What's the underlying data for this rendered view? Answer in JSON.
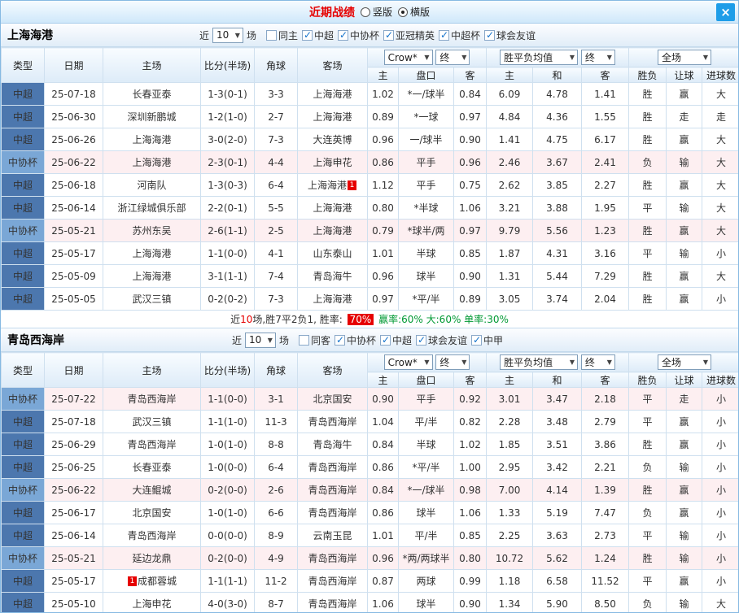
{
  "titlebar": {
    "title": "近期战绩",
    "radios": [
      {
        "label": "竖版",
        "selected": false
      },
      {
        "label": "横版",
        "selected": true
      }
    ],
    "close": "×"
  },
  "table_header": {
    "type": "类型",
    "date": "日期",
    "home": "主场",
    "score": "比分(半场)",
    "corner": "角球",
    "away": "客场",
    "asia_select": "Crow*",
    "asia_final": "终",
    "europe_select": "胜平负均值",
    "europe_final": "终",
    "full_select": "全场",
    "sub": [
      "主",
      "盘口",
      "客",
      "主",
      "和",
      "客",
      "胜负",
      "让球",
      "进球数"
    ]
  },
  "sections": [
    {
      "team": "上海海港",
      "filter": {
        "prefix": "近",
        "count": "10",
        "suffix": "场",
        "options": [
          {
            "label": "同主",
            "checked": false
          },
          {
            "label": "中超",
            "checked": true
          },
          {
            "label": "中协杯",
            "checked": true
          },
          {
            "label": "亚冠精英",
            "checked": true
          },
          {
            "label": "中超杯",
            "checked": true
          },
          {
            "label": "球会友谊",
            "checked": true
          }
        ]
      },
      "rows": [
        {
          "lg": "中超",
          "date": "25-07-18",
          "home": "长春亚泰",
          "home_c": "k",
          "score": "1-3(0-1)",
          "corner": "3-3",
          "away": "上海海港",
          "away_c": "g",
          "a1": "1.02",
          "hc": "*一/球半",
          "hc_c": "r",
          "a2": "0.84",
          "e1": "6.09",
          "e2": "4.78",
          "e3": "1.41",
          "r1": "胜",
          "r1c": "r",
          "r2": "赢",
          "r2c": "r",
          "r3": "大",
          "r3c": "r"
        },
        {
          "lg": "中超",
          "date": "25-06-30",
          "home": "深圳新鹏城",
          "home_c": "k",
          "score": "1-2(1-0)",
          "corner": "2-7",
          "away": "上海海港",
          "away_c": "g",
          "a1": "0.89",
          "hc": "*一球",
          "hc_c": "r",
          "a2": "0.97",
          "e1": "4.84",
          "e2": "4.36",
          "e3": "1.55",
          "r1": "胜",
          "r1c": "r",
          "r2": "走",
          "r2c": "b",
          "r3": "走",
          "r3c": "b"
        },
        {
          "lg": "中超",
          "date": "25-06-26",
          "home": "上海海港",
          "home_c": "r",
          "score": "3-0(2-0)",
          "corner": "7-3",
          "away": "大连英博",
          "away_c": "k",
          "a1": "0.96",
          "hc": "一/球半",
          "hc_c": "k",
          "a2": "0.90",
          "e1": "1.41",
          "e2": "4.75",
          "e3": "6.17",
          "r1": "胜",
          "r1c": "r",
          "r2": "赢",
          "r2c": "r",
          "r3": "大",
          "r3c": "r"
        },
        {
          "lg": "中协杯",
          "date": "25-06-22",
          "home": "上海海港",
          "home_c": "r",
          "score": "2-3(0-1)",
          "corner": "4-4",
          "away": "上海申花",
          "away_c": "k",
          "a1": "0.86",
          "hc": "平手",
          "hc_c": "k",
          "a2": "0.96",
          "e1": "2.46",
          "e2": "3.67",
          "e3": "2.41",
          "r1": "负",
          "r1c": "g",
          "r2": "输",
          "r2c": "g",
          "r3": "大",
          "r3c": "r"
        },
        {
          "lg": "中超",
          "date": "25-06-18",
          "home": "河南队",
          "home_c": "k",
          "score": "1-3(0-3)",
          "corner": "6-4",
          "away": "上海海港",
          "away_c": "g",
          "away_badge_post": "1",
          "a1": "1.12",
          "hc": "平手",
          "hc_c": "k",
          "a2": "0.75",
          "e1": "2.62",
          "e2": "3.85",
          "e3": "2.27",
          "r1": "胜",
          "r1c": "r",
          "r2": "赢",
          "r2c": "r",
          "r3": "大",
          "r3c": "r"
        },
        {
          "lg": "中超",
          "date": "25-06-14",
          "home": "浙江绿城俱乐部",
          "home_c": "k",
          "score": "2-2(0-1)",
          "corner": "5-5",
          "away": "上海海港",
          "away_c": "g",
          "a1": "0.80",
          "hc": "*半球",
          "hc_c": "r",
          "a2": "1.06",
          "e1": "3.21",
          "e2": "3.88",
          "e3": "1.95",
          "r1": "平",
          "r1c": "b",
          "r2": "输",
          "r2c": "g",
          "r3": "大",
          "r3c": "r"
        },
        {
          "lg": "中协杯",
          "date": "25-05-21",
          "home": "苏州东吴",
          "home_c": "k",
          "score": "2-6(1-1)",
          "corner": "2-5",
          "away": "上海海港",
          "away_c": "g",
          "a1": "0.79",
          "hc": "*球半/两",
          "hc_c": "r",
          "a2": "0.97",
          "e1": "9.79",
          "e2": "5.56",
          "e3": "1.23",
          "r1": "胜",
          "r1c": "r",
          "r2": "赢",
          "r2c": "r",
          "r3": "大",
          "r3c": "r"
        },
        {
          "lg": "中超",
          "date": "25-05-17",
          "home": "上海海港",
          "home_c": "r",
          "score": "1-1(0-0)",
          "corner": "4-1",
          "away": "山东泰山",
          "away_c": "k",
          "a1": "1.01",
          "hc": "半球",
          "hc_c": "k",
          "a2": "0.85",
          "e1": "1.87",
          "e2": "4.31",
          "e3": "3.16",
          "r1": "平",
          "r1c": "b",
          "r2": "输",
          "r2c": "g",
          "r3": "小",
          "r3c": "b"
        },
        {
          "lg": "中超",
          "date": "25-05-09",
          "home": "上海海港",
          "home_c": "r",
          "score": "3-1(1-1)",
          "corner": "7-4",
          "away": "青岛海牛",
          "away_c": "k",
          "a1": "0.96",
          "hc": "球半",
          "hc_c": "k",
          "a2": "0.90",
          "e1": "1.31",
          "e2": "5.44",
          "e3": "7.29",
          "r1": "胜",
          "r1c": "r",
          "r2": "赢",
          "r2c": "r",
          "r3": "大",
          "r3c": "r"
        },
        {
          "lg": "中超",
          "date": "25-05-05",
          "home": "武汉三镇",
          "home_c": "k",
          "score": "0-2(0-2)",
          "corner": "7-3",
          "away": "上海海港",
          "away_c": "g",
          "a1": "0.97",
          "hc": "*平/半",
          "hc_c": "r",
          "a2": "0.89",
          "e1": "3.05",
          "e2": "3.74",
          "e3": "2.04",
          "r1": "胜",
          "r1c": "r",
          "r2": "赢",
          "r2c": "r",
          "r3": "小",
          "r3c": "b"
        }
      ],
      "summary": {
        "segments": [
          {
            "text": "近",
            "color": "k"
          },
          {
            "text": "10",
            "color": "r"
          },
          {
            "text": "场,胜7平2负1, 胜率: ",
            "color": "k"
          },
          {
            "text": "70%",
            "color": "box"
          },
          {
            "text": " 赢率:60% 大:60% 单率:30%",
            "color": "g"
          }
        ]
      }
    },
    {
      "team": "青岛西海岸",
      "filter": {
        "prefix": "近",
        "count": "10",
        "suffix": "场",
        "options": [
          {
            "label": "同客",
            "checked": false
          },
          {
            "label": "中协杯",
            "checked": true
          },
          {
            "label": "中超",
            "checked": true
          },
          {
            "label": "球会友谊",
            "checked": true
          },
          {
            "label": "中甲",
            "checked": true
          }
        ]
      },
      "rows": [
        {
          "lg": "中协杯",
          "date": "25-07-22",
          "home": "青岛西海岸",
          "home_c": "g",
          "score": "1-1(0-0)",
          "corner": "3-1",
          "away": "北京国安",
          "away_c": "k",
          "a1": "0.90",
          "hc": "平手",
          "hc_c": "k",
          "a2": "0.92",
          "e1": "3.01",
          "e2": "3.47",
          "e3": "2.18",
          "r1": "平",
          "r1c": "b",
          "r2": "走",
          "r2c": "b",
          "r3": "小",
          "r3c": "b"
        },
        {
          "lg": "中超",
          "date": "25-07-18",
          "home": "武汉三镇",
          "home_c": "k",
          "score": "1-1(1-0)",
          "corner": "11-3",
          "away": "青岛西海岸",
          "away_c": "g",
          "a1": "1.04",
          "hc": "平/半",
          "hc_c": "k",
          "a2": "0.82",
          "e1": "2.28",
          "e2": "3.48",
          "e3": "2.79",
          "r1": "平",
          "r1c": "b",
          "r2": "赢",
          "r2c": "r",
          "r3": "小",
          "r3c": "b"
        },
        {
          "lg": "中超",
          "date": "25-06-29",
          "home": "青岛西海岸",
          "home_c": "g",
          "score": "1-0(1-0)",
          "corner": "8-8",
          "away": "青岛海牛",
          "away_c": "k",
          "a1": "0.84",
          "hc": "半球",
          "hc_c": "k",
          "a2": "1.02",
          "e1": "1.85",
          "e2": "3.51",
          "e3": "3.86",
          "r1": "胜",
          "r1c": "r",
          "r2": "赢",
          "r2c": "r",
          "r3": "小",
          "r3c": "b"
        },
        {
          "lg": "中超",
          "date": "25-06-25",
          "home": "长春亚泰",
          "home_c": "k",
          "score": "1-0(0-0)",
          "corner": "6-4",
          "away": "青岛西海岸",
          "away_c": "g",
          "a1": "0.86",
          "hc": "*平/半",
          "hc_c": "r",
          "a2": "1.00",
          "e1": "2.95",
          "e2": "3.42",
          "e3": "2.21",
          "r1": "负",
          "r1c": "g",
          "r2": "输",
          "r2c": "g",
          "r3": "小",
          "r3c": "b"
        },
        {
          "lg": "中协杯",
          "date": "25-06-22",
          "home": "大连鲲城",
          "home_c": "k",
          "score": "0-2(0-0)",
          "corner": "2-6",
          "away": "青岛西海岸",
          "away_c": "g",
          "a1": "0.84",
          "hc": "*一/球半",
          "hc_c": "r",
          "a2": "0.98",
          "e1": "7.00",
          "e2": "4.14",
          "e3": "1.39",
          "r1": "胜",
          "r1c": "r",
          "r2": "赢",
          "r2c": "r",
          "r3": "小",
          "r3c": "b"
        },
        {
          "lg": "中超",
          "date": "25-06-17",
          "home": "北京国安",
          "home_c": "k",
          "score": "1-0(1-0)",
          "corner": "6-6",
          "away": "青岛西海岸",
          "away_c": "g",
          "a1": "0.86",
          "hc": "球半",
          "hc_c": "k",
          "a2": "1.06",
          "e1": "1.33",
          "e2": "5.19",
          "e3": "7.47",
          "r1": "负",
          "r1c": "g",
          "r2": "赢",
          "r2c": "r",
          "r3": "小",
          "r3c": "b"
        },
        {
          "lg": "中超",
          "date": "25-06-14",
          "home": "青岛西海岸",
          "home_c": "g",
          "score": "0-0(0-0)",
          "corner": "8-9",
          "away": "云南玉昆",
          "away_c": "k",
          "a1": "1.01",
          "hc": "平/半",
          "hc_c": "k",
          "a2": "0.85",
          "e1": "2.25",
          "e2": "3.63",
          "e3": "2.73",
          "r1": "平",
          "r1c": "b",
          "r2": "输",
          "r2c": "g",
          "r3": "小",
          "r3c": "b"
        },
        {
          "lg": "中协杯",
          "date": "25-05-21",
          "home": "延边龙鼎",
          "home_c": "k",
          "score": "0-2(0-0)",
          "corner": "4-9",
          "away": "青岛西海岸",
          "away_c": "g",
          "a1": "0.96",
          "hc": "*两/两球半",
          "hc_c": "r",
          "a2": "0.80",
          "e1": "10.72",
          "e2": "5.62",
          "e3": "1.24",
          "r1": "胜",
          "r1c": "r",
          "r2": "输",
          "r2c": "g",
          "r3": "小",
          "r3c": "b"
        },
        {
          "lg": "中超",
          "date": "25-05-17",
          "home": "成都蓉城",
          "home_c": "k",
          "home_badge_pre": "1",
          "score": "1-1(1-1)",
          "corner": "11-2",
          "away": "青岛西海岸",
          "away_c": "g",
          "a1": "0.87",
          "hc": "两球",
          "hc_c": "k",
          "a2": "0.99",
          "e1": "1.18",
          "e2": "6.58",
          "e3": "11.52",
          "r1": "平",
          "r1c": "b",
          "r2": "赢",
          "r2c": "r",
          "r3": "小",
          "r3c": "b"
        },
        {
          "lg": "中超",
          "date": "25-05-10",
          "home": "上海申花",
          "home_c": "k",
          "score": "4-0(3-0)",
          "corner": "8-7",
          "away": "青岛西海岸",
          "away_c": "g",
          "a1": "1.06",
          "hc": "球半",
          "hc_c": "k",
          "a2": "0.90",
          "e1": "1.34",
          "e2": "5.90",
          "e3": "8.50",
          "r1": "负",
          "r1c": "g",
          "r2": "输",
          "r2c": "g",
          "r3": "大",
          "r3c": "r"
        }
      ]
    }
  ]
}
